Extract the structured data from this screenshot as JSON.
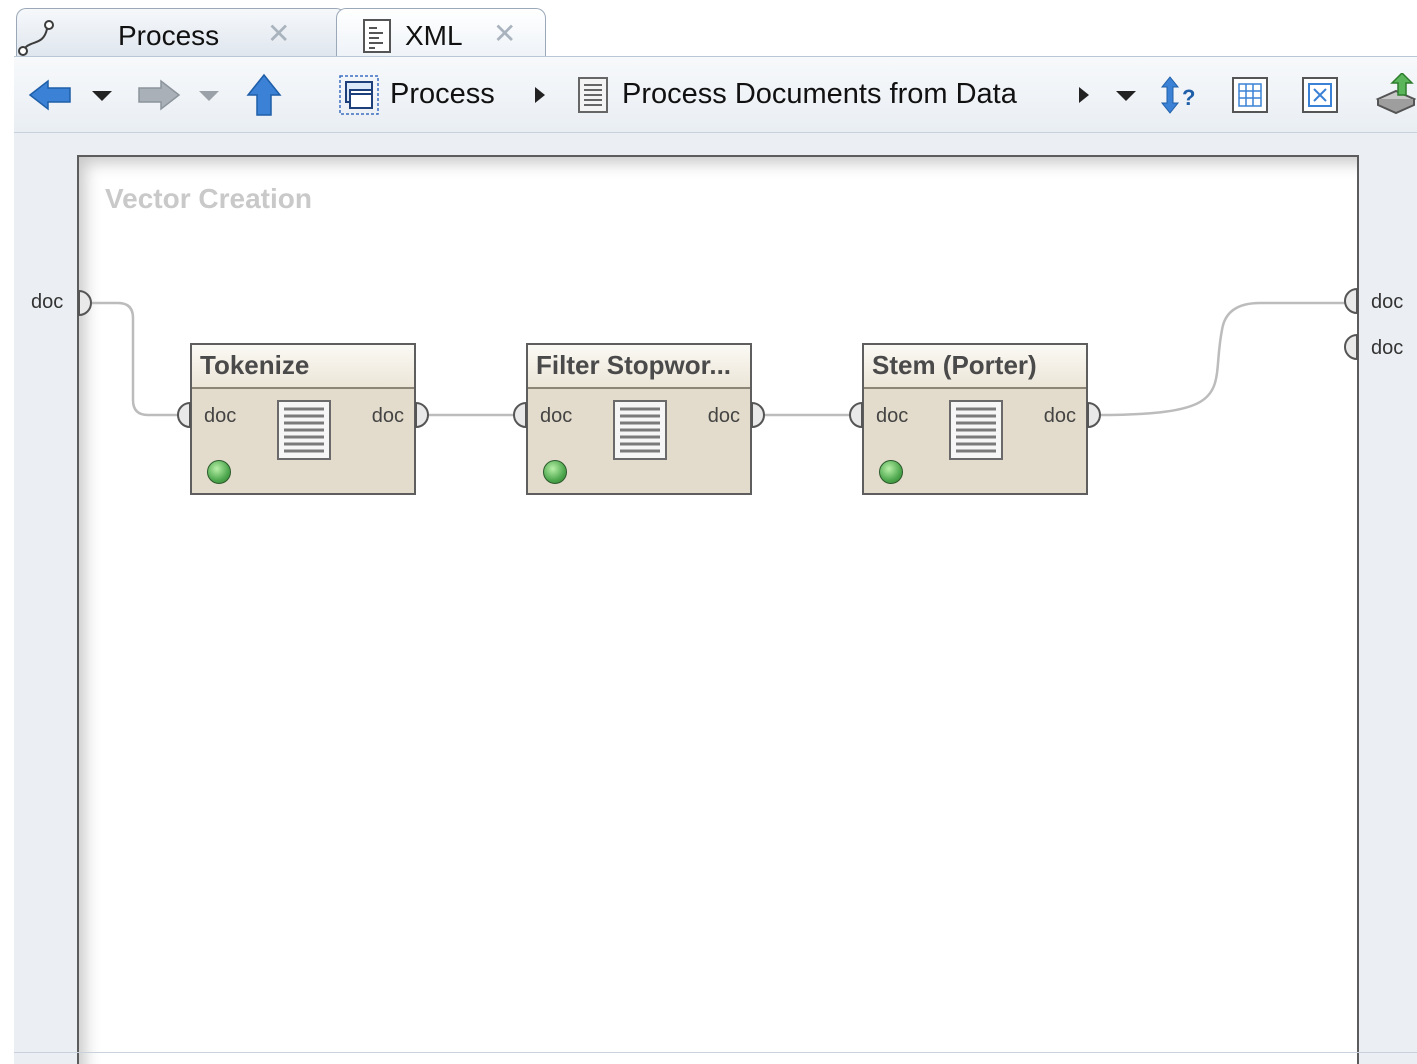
{
  "tabs": [
    {
      "label": "Process",
      "icon": "process-flow-icon",
      "close_icon": "close-icon"
    },
    {
      "label": "XML",
      "icon": "xml-document-icon",
      "close_icon": "close-icon"
    }
  ],
  "toolbar": {
    "breadcrumbs": [
      {
        "label": "Process",
        "icon": "subprocess-icon"
      },
      {
        "label": "Process Documents from Data",
        "icon": "document-operator-icon"
      }
    ],
    "icons": [
      "back-arrow-icon",
      "chevron-down-icon",
      "forward-arrow-icon",
      "chevron-down-icon",
      "up-arrow-icon",
      "auto-wire-icon",
      "grid-icon",
      "fit-icon",
      "export-icon"
    ]
  },
  "canvas": {
    "title": "Vector Creation",
    "input_ports": [
      "doc"
    ],
    "output_ports": [
      "doc",
      "doc"
    ]
  },
  "operators": [
    {
      "name": "Tokenize",
      "in_port": "doc",
      "out_port": "doc",
      "status": "ok"
    },
    {
      "name": "Filter Stopwor...",
      "in_port": "doc",
      "out_port": "doc",
      "status": "ok"
    },
    {
      "name": "Stem (Porter)",
      "in_port": "doc",
      "out_port": "doc",
      "status": "ok"
    }
  ],
  "colors": {
    "operator_body": "#e3dccc",
    "status_ok": "#4ea84e",
    "arrow_blue": "#3b82d6",
    "canvas_title": "#c9c9c9"
  }
}
